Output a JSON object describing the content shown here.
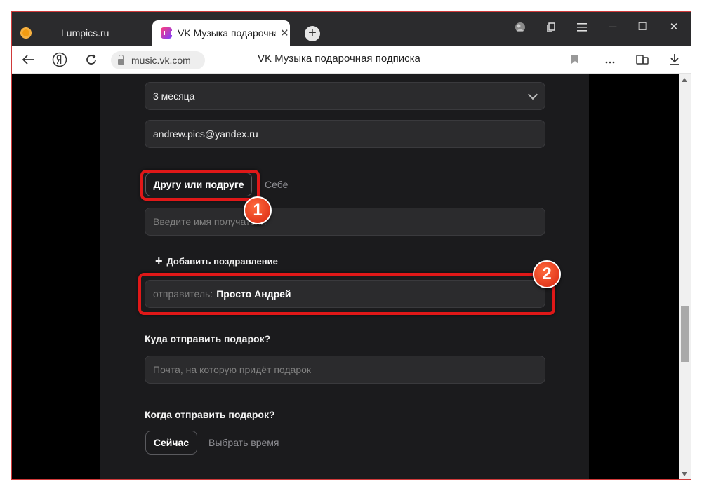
{
  "tabs": [
    {
      "title": "Lumpics.ru"
    },
    {
      "title": "VK Музыка подарочная подписка",
      "close": "✕"
    }
  ],
  "toolbar": {
    "new_tab": "+",
    "minimize": "─",
    "maximize": "☐",
    "close": "✕"
  },
  "address": {
    "url": "music.vk.com",
    "page_title": "VK Музыка подарочная подписка"
  },
  "form": {
    "period": "3 месяца",
    "email": "andrew.pics@yandex.ru",
    "recipient_options": {
      "active": "Другу или подруге",
      "inactive": "Себе"
    },
    "name_placeholder": "Введите имя получателя",
    "add_greeting": "Добавить поздравление",
    "sender_label": "отправитель:",
    "sender_name": "Просто Андрей",
    "where_heading": "Куда отправить подарок?",
    "where_placeholder": "Почта, на которую придёт подарок",
    "when_heading": "Когда отправить подарок?",
    "when_options": {
      "active": "Сейчас",
      "inactive": "Выбрать время"
    }
  },
  "annotations": [
    {
      "label": "1"
    },
    {
      "label": "2"
    }
  ],
  "colors": {
    "highlight": "#e01818",
    "badge": "#e8401c",
    "panel": "#1b1b1d"
  }
}
